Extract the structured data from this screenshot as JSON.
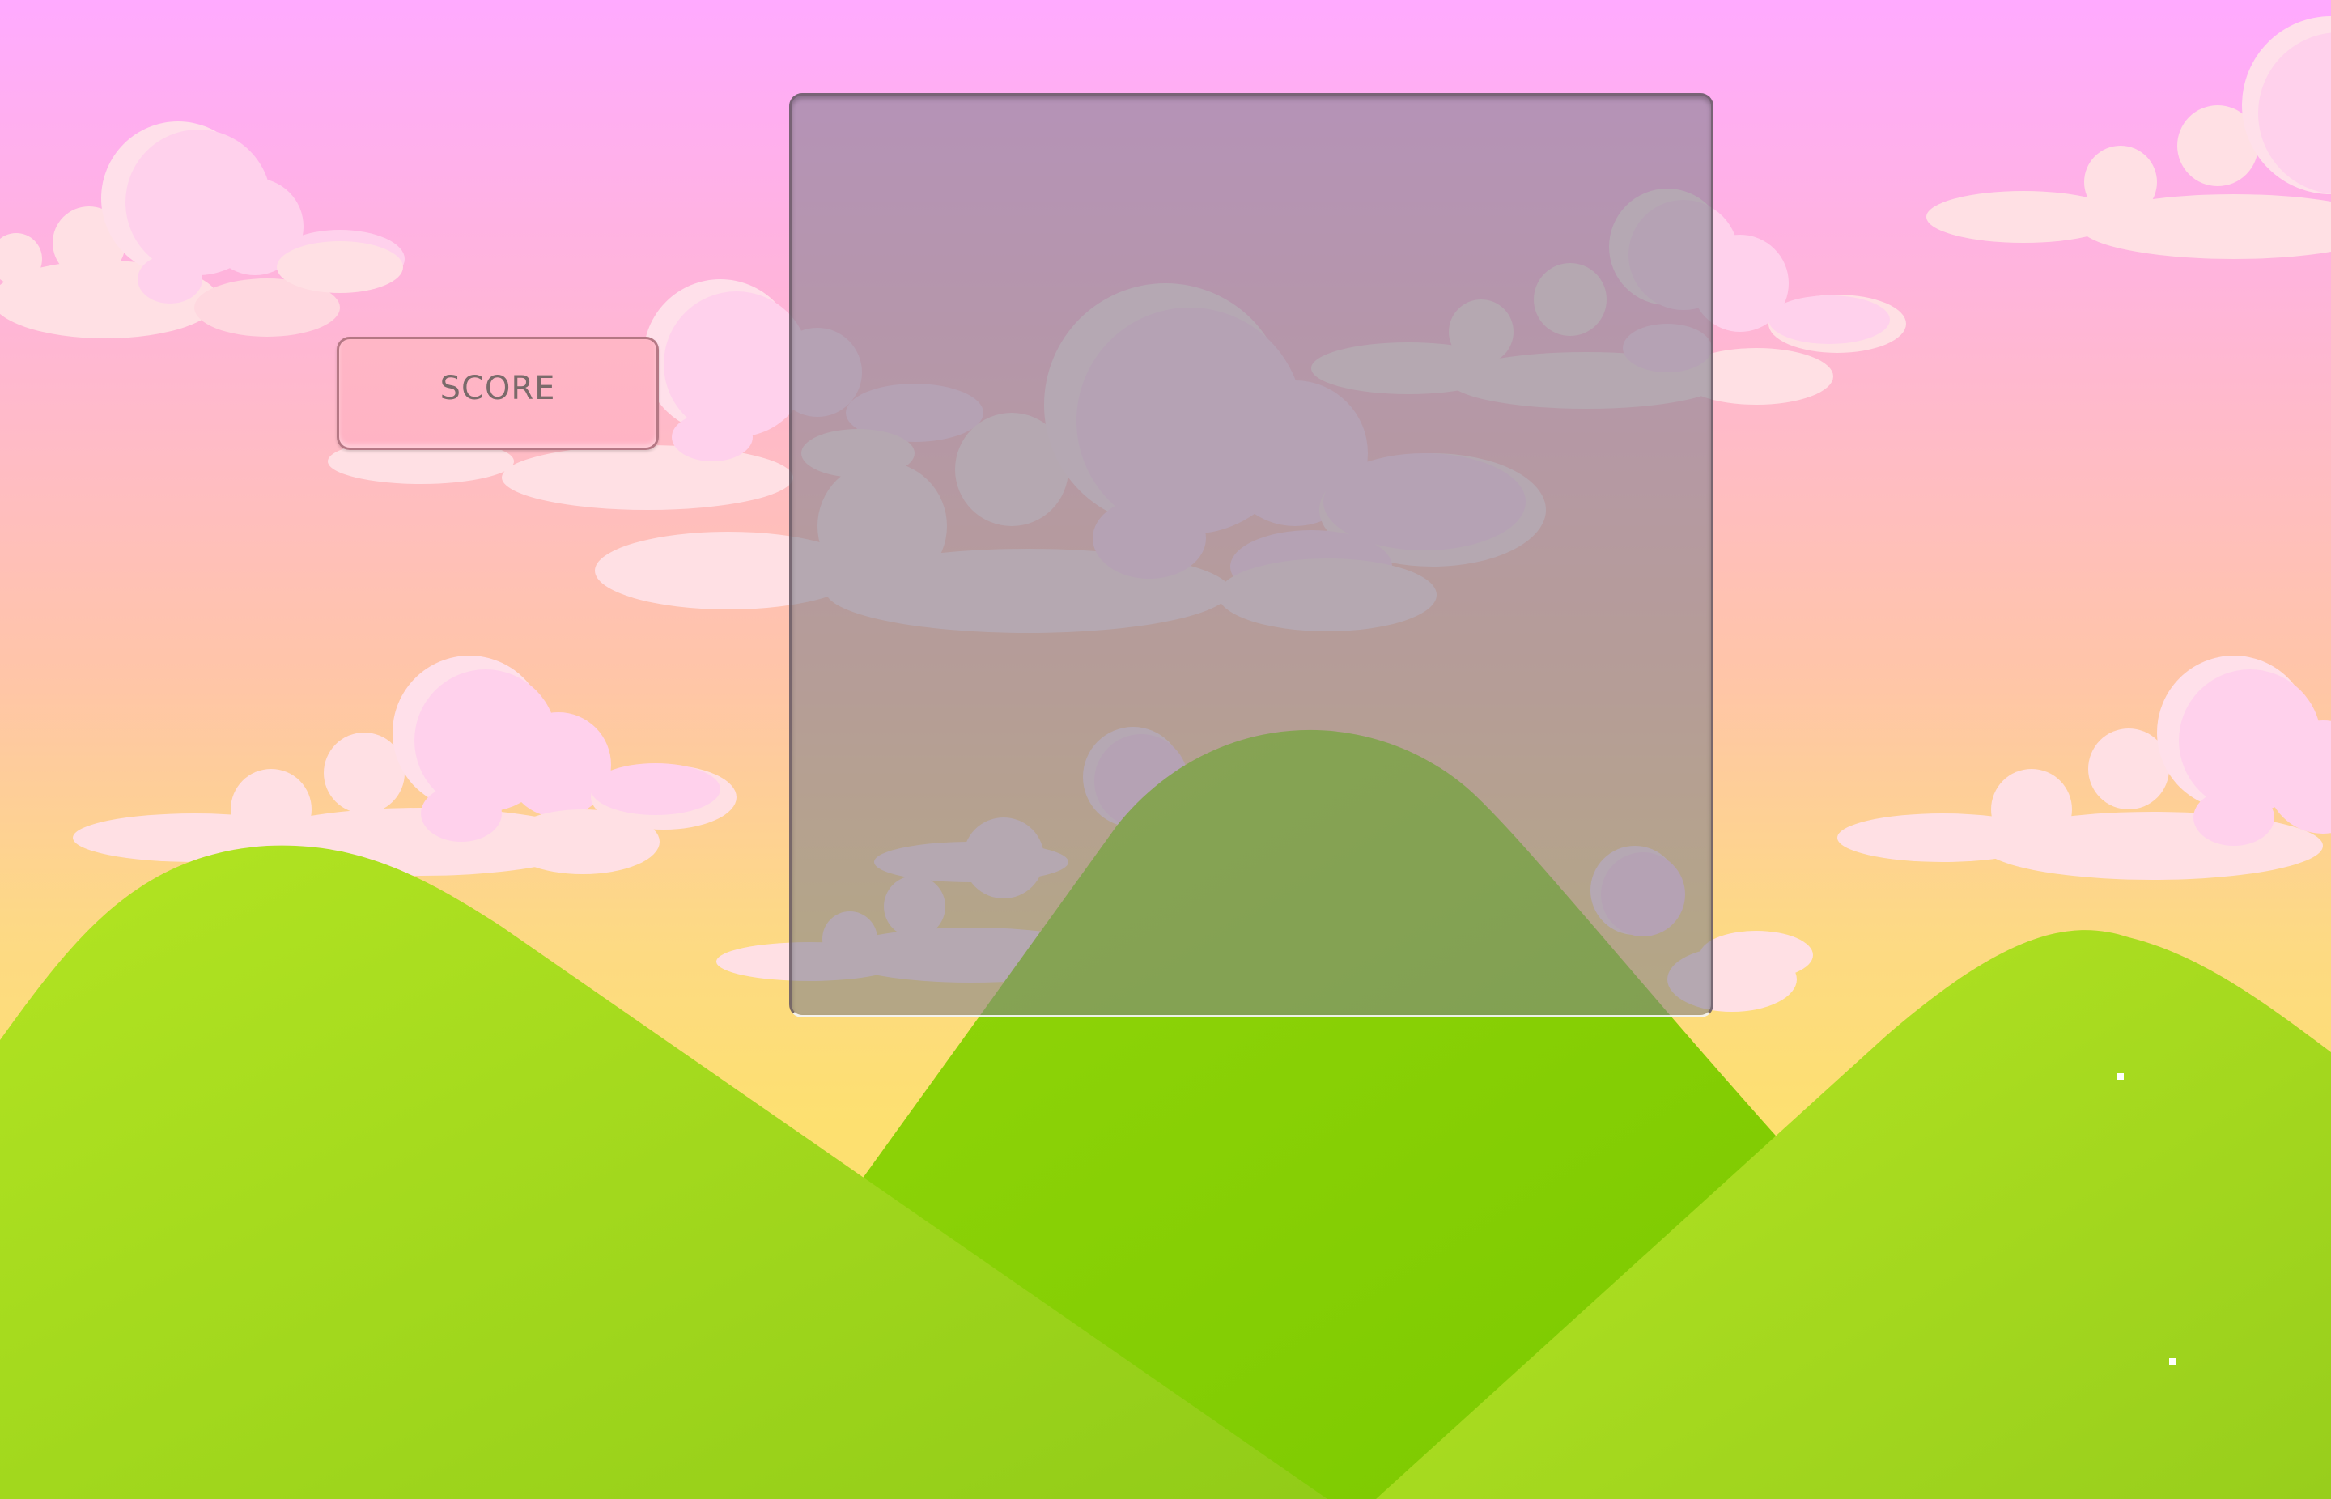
{
  "game": {
    "score_label": "SCORE"
  },
  "colors": {
    "sky_top": "#ffaaff",
    "sky_middle": "#ffc5a8",
    "sky_bottom": "#fde070",
    "cloud_light": "#ffe0e4",
    "cloud_pink": "#ffd1ec",
    "hill_front": "#a8e01e",
    "hill_back": "#86d000",
    "score_panel": "#ffb6c6",
    "board_overlay": "#80808c"
  }
}
